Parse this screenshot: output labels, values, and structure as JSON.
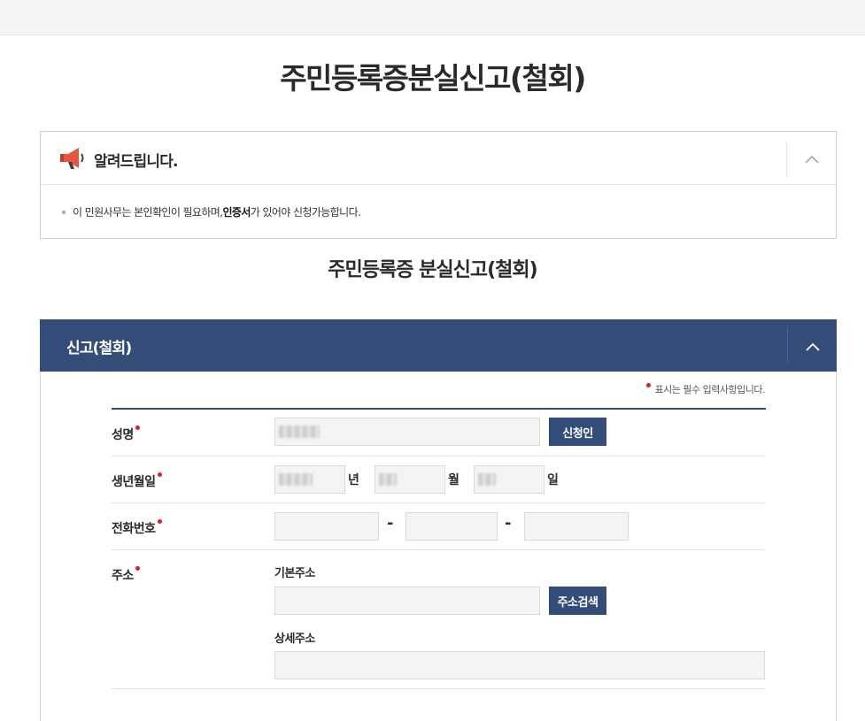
{
  "page": {
    "title": "주민등록증분실신고(철회)",
    "subtitle": "주민등록증 분실신고(철회)"
  },
  "notice": {
    "icon": "megaphone-icon",
    "title": "알려드립니다.",
    "text_before": "이 민원사무는 본인확인이 필요하며, ",
    "text_bold": "인증서",
    "text_after": "가 있어야 신청가능합니다.",
    "toggle_icon": "chevron-up-icon"
  },
  "panel": {
    "title": "신고(철회)",
    "toggle_icon": "chevron-up-icon",
    "header_color": "#344d78",
    "required_note": "표시는 필수 입력사항입니다."
  },
  "form": {
    "name": {
      "label": "성명",
      "button": "신청인"
    },
    "birth": {
      "label": "생년월일",
      "year_unit": "년",
      "month_unit": "월",
      "day_unit": "일"
    },
    "phone": {
      "label": "전화번호",
      "sep1": "-",
      "sep2": "-"
    },
    "address": {
      "label": "주소",
      "basic_label": "기본주소",
      "search_button": "주소검색",
      "detail_label": "상세주소"
    }
  },
  "colors": {
    "accent": "#344d78",
    "required": "#e01d2d"
  }
}
